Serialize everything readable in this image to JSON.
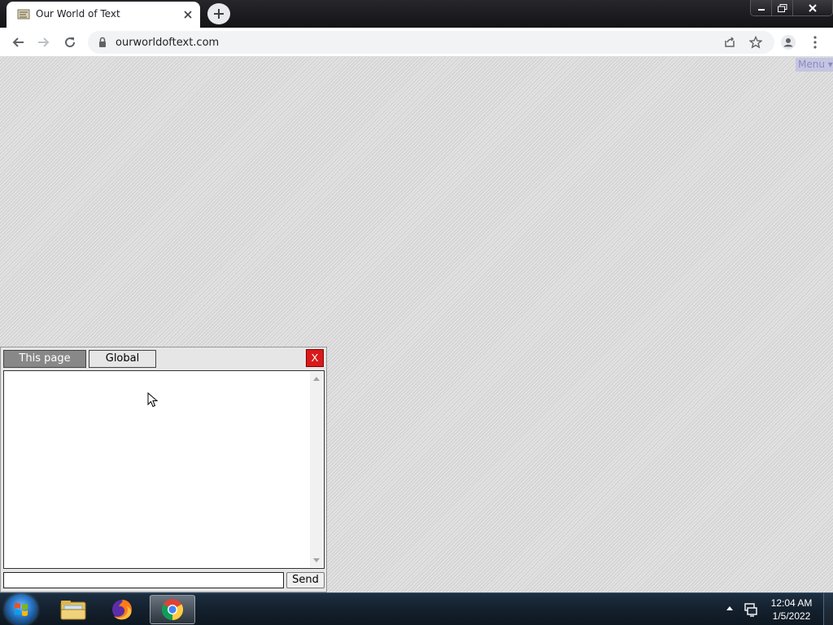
{
  "browser": {
    "tab": {
      "title": "Our World of Text"
    },
    "address_bar": {
      "url": "ourworldoftext.com"
    }
  },
  "page": {
    "menu_label": "Menu",
    "chat": {
      "tabs": [
        {
          "label": "This page",
          "active": true
        },
        {
          "label": "Global",
          "active": false
        }
      ],
      "close_label": "X",
      "input": {
        "value": "",
        "placeholder": ""
      },
      "send_label": "Send"
    }
  },
  "taskbar": {
    "apps": [
      {
        "name": "File Explorer",
        "icon": "folder-icon",
        "active": false
      },
      {
        "name": "Firefox",
        "icon": "firefox-icon",
        "active": false
      },
      {
        "name": "Chrome",
        "icon": "chrome-icon",
        "active": true
      }
    ],
    "clock": {
      "time": "12:04 AM",
      "date": "1/5/2022"
    }
  },
  "colors": {
    "chat_close": "#d91a1a",
    "active_tab": "#888888",
    "taskbar": "#14202d"
  }
}
